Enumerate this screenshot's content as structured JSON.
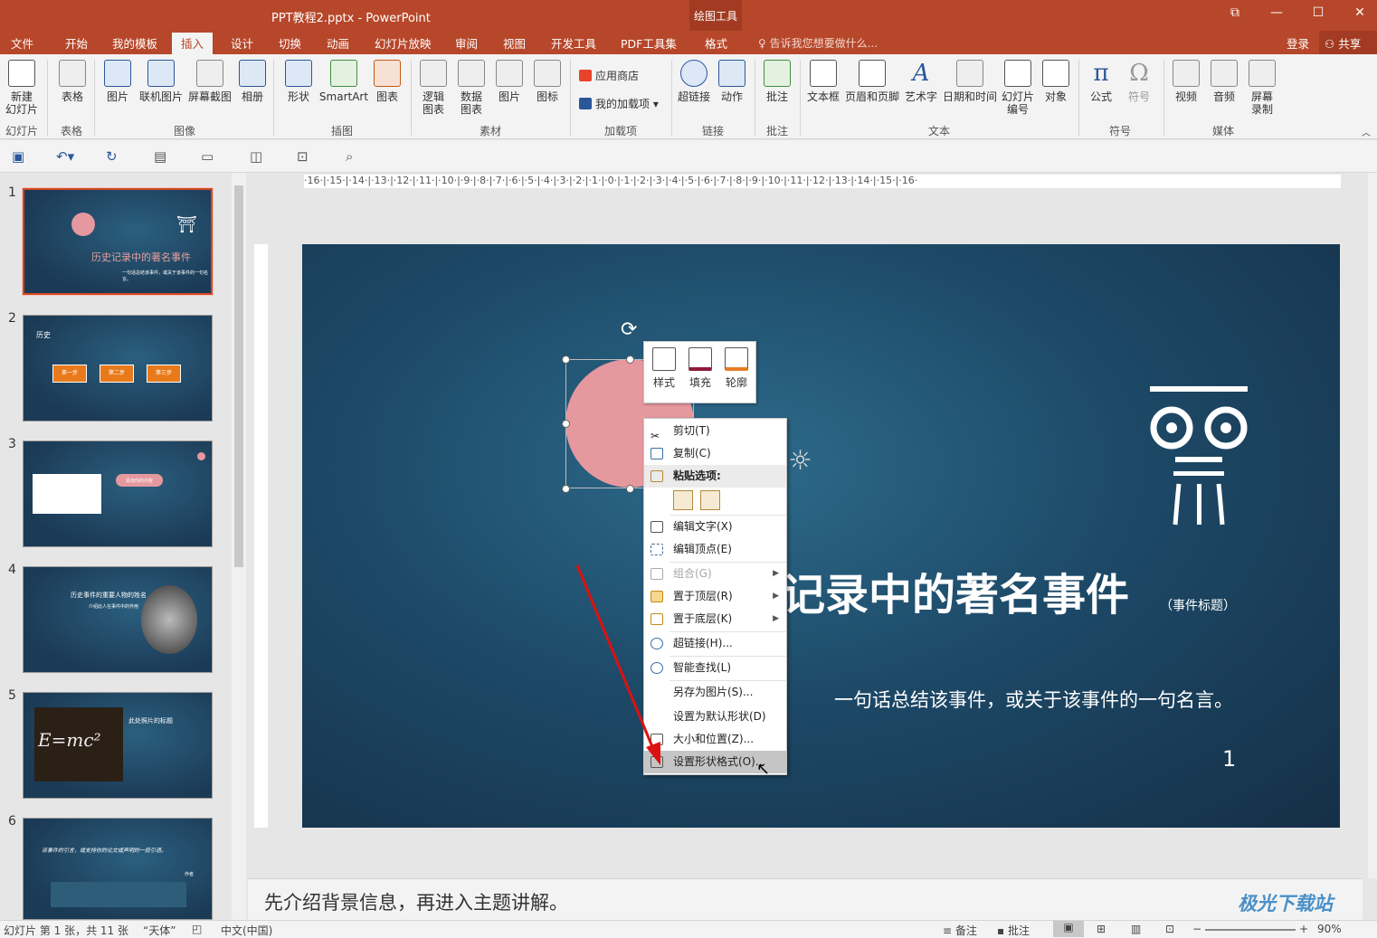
{
  "window": {
    "title": "PPT教程2.pptx - PowerPoint",
    "contextual_tab_group": "绘图工具",
    "controls": {
      "restore_ribbon": "⧉",
      "minimize": "—",
      "maximize": "☐",
      "close": "✕"
    }
  },
  "tabs": [
    "文件",
    "开始",
    "我的模板",
    "插入",
    "设计",
    "切换",
    "动画",
    "幻灯片放映",
    "审阅",
    "视图",
    "开发工具",
    "PDF工具集",
    "格式"
  ],
  "active_tab": "插入",
  "tell_me": "告诉我您想要做什么...",
  "account": {
    "login": "登录",
    "share": "共享"
  },
  "ribbon": {
    "buttons": {
      "new_slide": "新建\n幻灯片",
      "table": "表格",
      "picture": "图片",
      "online_picture": "联机图片",
      "screenshot": "屏幕截图",
      "album": "相册",
      "shapes": "形状",
      "smartart": "SmartArt",
      "chart": "图表",
      "logic_chart": "逻辑\n图表",
      "data_chart": "数据\n图表",
      "picture2": "图片",
      "icon": "图标",
      "store": "应用商店",
      "my_addins": "我的加载项",
      "hyperlink": "超链接",
      "action": "动作",
      "comment": "批注",
      "textbox": "文本框",
      "header_footer": "页眉和页脚",
      "wordart": "艺术字",
      "datetime": "日期和时间",
      "slide_number": "幻灯片\n编号",
      "object": "对象",
      "equation": "公式",
      "symbol": "符号",
      "video": "视频",
      "audio": "音频",
      "screen_record": "屏幕\n录制"
    },
    "groups": {
      "slides": "幻灯片",
      "tables": "表格",
      "images": "图像",
      "illustrations": "插图",
      "material": "素材",
      "addins": "加载项",
      "links": "链接",
      "comments": "批注",
      "text": "文本",
      "symbols": "符号",
      "media": "媒体"
    }
  },
  "ruler": {
    "horizontal": "·16·|·15·|·14·|·13·|·12·|·11·|·10·|·9·|·8·|·7·|·6·|·5·|·4·|·3·|·2·|·1·|·0·|·1·|·2·|·3·|·4·|·5·|·6·|·7·|·8·|·9·|·10·|·11·|·12·|·13·|·14·|·15·|·16·"
  },
  "thumbnails": [
    {
      "num": "1",
      "title": "历史记录中的著名事件",
      "sub": "一句话总结该事件，或关于该事件的一句名言。"
    },
    {
      "num": "2",
      "title": "历史",
      "steps": [
        "第一步",
        "第二步",
        "第三步"
      ]
    },
    {
      "num": "3",
      "bubble": "添加你的内容"
    },
    {
      "num": "4",
      "title": "历史事件的重要人物的姓名",
      "sub": "介绍此人在事件中的作用"
    },
    {
      "num": "5",
      "title": "此处照片的标题",
      "formula": "E=mc²"
    },
    {
      "num": "6",
      "quote": "该事件的引言，或支持你的论文或声明的一段引语。",
      "author": "作者"
    }
  ],
  "slide": {
    "title": "记录中的著名事件",
    "title_note": "（事件标题）",
    "subtitle": "一句话总结该事件，或关于该事件的一句名言。",
    "number": "1"
  },
  "mini_toolbar": {
    "style": "样式",
    "fill": "填充",
    "outline": "轮廓"
  },
  "context_menu": {
    "cut": "剪切(T)",
    "copy": "复制(C)",
    "paste_options": "粘贴选项:",
    "edit_text": "编辑文字(X)",
    "edit_points": "编辑顶点(E)",
    "group": "组合(G)",
    "bring_front": "置于顶层(R)",
    "send_back": "置于底层(K)",
    "hyperlink": "超链接(H)...",
    "smart_lookup": "智能查找(L)",
    "save_as_picture": "另存为图片(S)...",
    "set_default": "设置为默认形状(D)",
    "size_position": "大小和位置(Z)...",
    "format_shape": "设置形状格式(O)..."
  },
  "notes": "先介绍背景信息，再进入主题讲解。",
  "status": {
    "slide_info": "幻灯片 第 1 张，共 11 张",
    "theme": "“天体”",
    "language": "中文(中国)",
    "notes": "备注",
    "comments": "批注",
    "zoom": "90%"
  },
  "watermark": "极光下载站"
}
